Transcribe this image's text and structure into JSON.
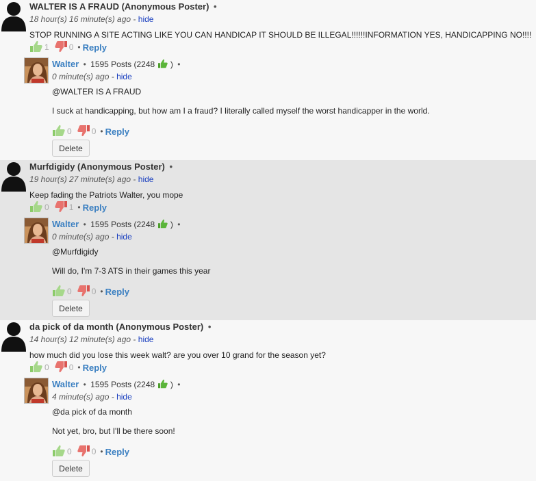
{
  "comments": [
    {
      "author": "WALTER IS A FRAUD (Anonymous Poster)",
      "time": "18 hour(s) 16 minute(s) ago",
      "hide": "hide",
      "text": "STOP RUNNING A SITE ACTING LIKE YOU CAN HANDICAP IT SHOULD BE ILLEGAL!!!!!!INFORMATION YES, HANDICAPPING NO!!!!",
      "up": "1",
      "down": "0",
      "reply": "Reply",
      "response": {
        "user": "Walter",
        "posts": "1595 Posts (2248",
        "posts_close": ")",
        "time": "0 minute(s) ago",
        "hide": "hide",
        "mention": "@WALTER IS A FRAUD",
        "text": "I suck at handicapping, but how am I a fraud? I literally called myself the worst handicapper in the world.",
        "up": "0",
        "down": "0",
        "reply": "Reply",
        "delete": "Delete"
      }
    },
    {
      "author": "Murfdigidy (Anonymous Poster)",
      "time": "19 hour(s) 27 minute(s) ago",
      "hide": "hide",
      "text": "Keep fading the Patriots Walter,  you mope",
      "up": "0",
      "down": "1",
      "reply": "Reply",
      "response": {
        "user": "Walter",
        "posts": "1595 Posts (2248",
        "posts_close": ")",
        "time": "0 minute(s) ago",
        "hide": "hide",
        "mention": "@Murfdigidy",
        "text": "Will do, I'm 7-3 ATS in their games this year",
        "up": "0",
        "down": "0",
        "reply": "Reply",
        "delete": "Delete"
      }
    },
    {
      "author": "da pick of da month (Anonymous Poster)",
      "time": "14 hour(s) 12 minute(s) ago",
      "hide": "hide",
      "text": "how much did you lose this week walt? are you over 10 grand for the season yet?",
      "up": "0",
      "down": "0",
      "reply": "Reply",
      "response": {
        "user": "Walter",
        "posts": "1595 Posts (2248",
        "posts_close": ")",
        "time": "4 minute(s) ago",
        "hide": "hide",
        "mention": "@da pick of da month",
        "text": "Not yet, bro, but I'll be there soon!",
        "up": "0",
        "down": "0",
        "reply": "Reply",
        "delete": "Delete"
      }
    }
  ],
  "separator": "•",
  "colors": {
    "link": "#3a7fc1",
    "hide_link": "#1a3fbf",
    "thumb_up": "#7fc25a",
    "thumb_down": "#e0605a",
    "shaded_bg": "#e5e5e5"
  },
  "icons": {
    "anon_avatar": "silhouette-avatar",
    "user_avatar": "user-photo-avatar",
    "up": "thumbs-up-icon",
    "down": "thumbs-down-icon"
  }
}
